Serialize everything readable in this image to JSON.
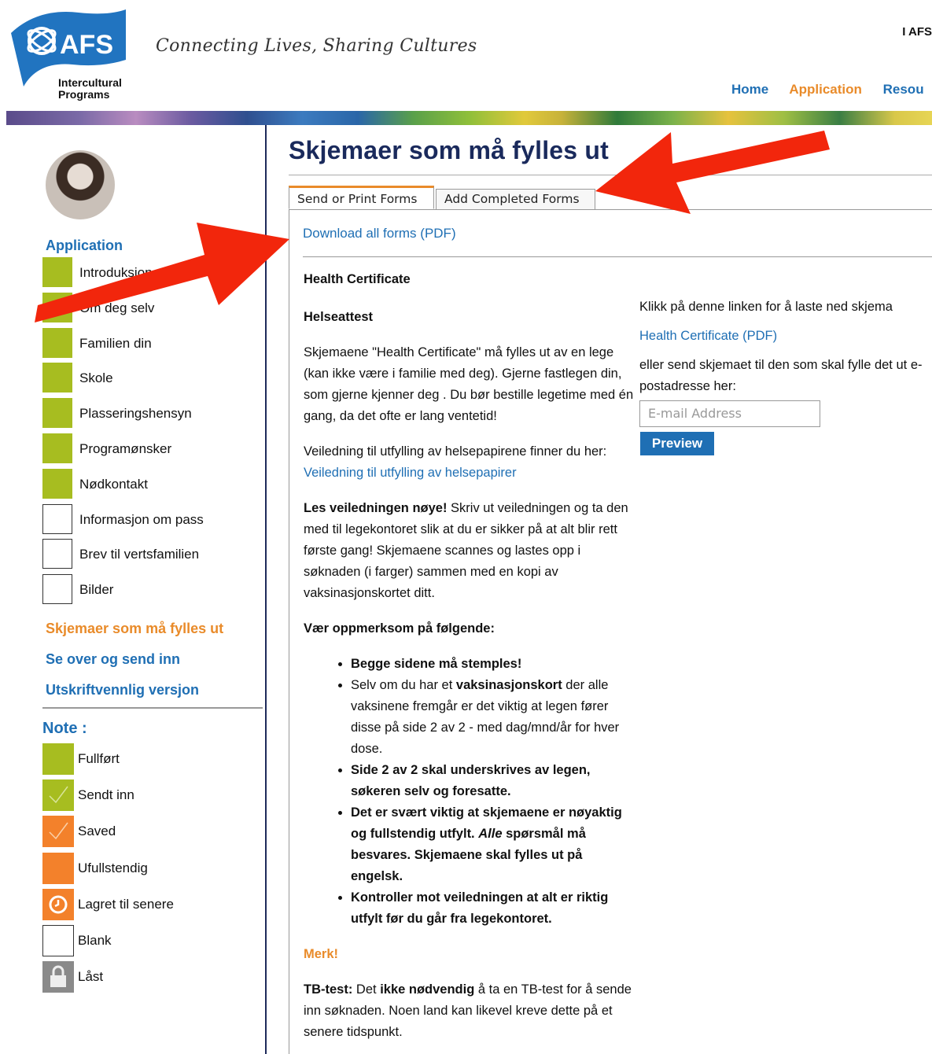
{
  "header": {
    "logo_text": "AFS",
    "logo_subtitle_1": "Intercultural",
    "logo_subtitle_2": "Programs",
    "tagline": "Connecting Lives, Sharing Cultures",
    "top_right": "I AFS",
    "nav": [
      "Home",
      "Application",
      "Resou"
    ]
  },
  "sidebar": {
    "heading": "Application",
    "items": [
      {
        "label": "Introduksjon",
        "status": "complete"
      },
      {
        "label": "Om deg selv",
        "status": "complete"
      },
      {
        "label": "Familien din",
        "status": "complete"
      },
      {
        "label": "Skole",
        "status": "complete"
      },
      {
        "label": "Plasseringshensyn",
        "status": "complete"
      },
      {
        "label": "Programønsker",
        "status": "complete"
      },
      {
        "label": "Nødkontakt",
        "status": "complete"
      },
      {
        "label": "Informasjon om pass",
        "status": "blank"
      },
      {
        "label": "Brev til vertsfamilien",
        "status": "blank"
      },
      {
        "label": "Bilder",
        "status": "blank"
      }
    ],
    "links": [
      "Skjemaer som må fylles ut",
      "Se over og send inn",
      "Utskriftvennlig versjon"
    ],
    "note_heading": "Note :",
    "legend": [
      "Fullført",
      "Sendt inn",
      "Saved",
      "Ufullstendig",
      "Lagret til senere",
      "Blank",
      "Låst"
    ]
  },
  "main": {
    "title": "Skjemaer som må fylles ut",
    "tabs": [
      "Send or Print Forms",
      "Add Completed Forms"
    ],
    "download_all": "Download all forms (PDF)",
    "section_title": "Health Certificate",
    "subtitle": "Helseattest",
    "para1": "Skjemaene \"Health Certificate\" må fylles ut av en lege (kan ikke være i familie med deg). Gjerne fastlegen din, som gjerne kjenner deg . Du bør bestille legetime med én gang, da det ofte er lang ventetid!",
    "para2_prefix": "Veiledning til utfylling av helsepapirene finner du her: ",
    "para2_link": "Veiledning til utfylling av helsepapirer",
    "para3_bold": "Les veiledningen nøye!",
    "para3_rest": " Skriv ut veiledningen og ta den med til legekontoret slik at du er sikker på at alt blir rett første gang! Skjemaene scannes og lastes opp i søknaden (i farger) sammen med en kopi av vaksinasjonskortet ditt.",
    "attention": "Vær oppmerksom på følgende:",
    "bullet1": "Begge sidene må stemples!",
    "bullet2_a": "Selv om du har et ",
    "bullet2_b": "vaksinasjonskort",
    "bullet2_c": " der alle vaksinene fremgår er det viktig at legen fører disse på side 2 av 2 - med dag/mnd/år for hver dose.",
    "bullet3": "Side 2 av 2 skal underskrives av legen, søkeren selv og foresatte.",
    "bullet4_a": "Det er svært viktig at skjemaene er nøyaktig og fullstendig utfylt. ",
    "bullet4_b": "Alle",
    "bullet4_c": " spørsmål må besvares. Skjemaene skal fylles ut på engelsk.",
    "bullet5": "Kontroller mot veiledningen at alt er riktig utfylt før du går fra legekontoret.",
    "merk": "Merk!",
    "tb_bold": "TB-test:",
    "tb_a": " Det ",
    "tb_b": "ikke nødvendig",
    "tb_c": " å ta en TB-test for å sende inn søknaden. Noen land kan likevel kreve dette på et senere tidspunkt.",
    "right_text1": "Klikk på denne linken for å laste ned skjema",
    "right_link": "Health Certificate (PDF)",
    "right_text2": "eller send skjemaet til den som skal fylle det ut e-postadresse her:",
    "email_placeholder": "E-mail Address",
    "preview_button": "Preview"
  },
  "colors": {
    "brand_blue": "#1f6fb4",
    "orange": "#e98b2a",
    "status_green": "#a7bd20",
    "arrow_red": "#f2260c"
  }
}
